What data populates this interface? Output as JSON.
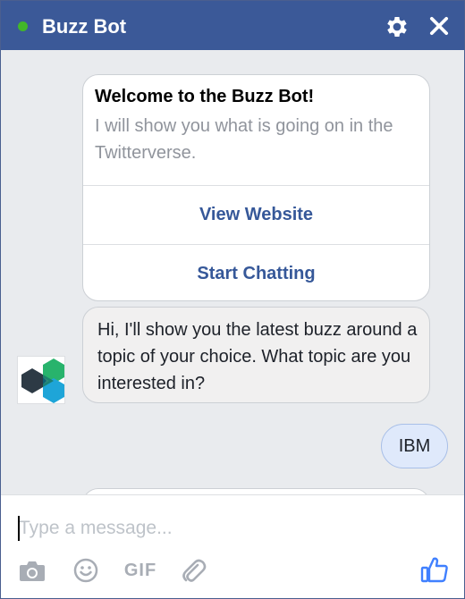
{
  "window": {
    "title": "Buzz Bot",
    "status": "online",
    "icons": {
      "status": "online-dot-icon",
      "settings": "gear-icon",
      "close": "close-icon"
    },
    "colors": {
      "header": "#3b5998",
      "online": "#42b72a",
      "link": "#365899"
    }
  },
  "messages": {
    "welcome_card": {
      "title": "Welcome to the Buzz Bot!",
      "subtitle": "I will show you what is going on in the Twitterverse.",
      "buttons": [
        {
          "label": "View Website"
        },
        {
          "label": "Start Chatting"
        }
      ]
    },
    "bot_message": {
      "text": "Hi, I'll show you the latest buzz around a topic of your choice. What topic are you interested in?",
      "avatar": "hexagon-logo-icon"
    },
    "user_message": {
      "text": "IBM"
    }
  },
  "composer": {
    "placeholder": "Type a message...",
    "tools": [
      {
        "name": "camera-icon"
      },
      {
        "name": "emoji-icon"
      },
      {
        "label": "GIF"
      },
      {
        "name": "paperclip-icon"
      }
    ],
    "like": "thumbs-up-icon"
  }
}
